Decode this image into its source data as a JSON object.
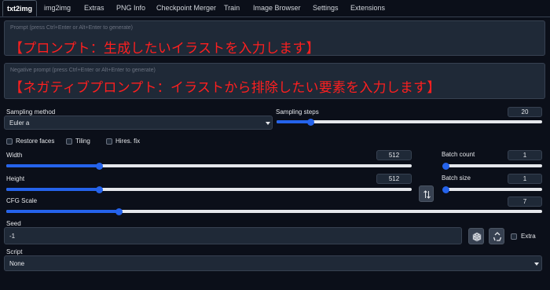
{
  "tabs": [
    {
      "label": "txt2img"
    },
    {
      "label": "img2img"
    },
    {
      "label": "Extras"
    },
    {
      "label": "PNG Info"
    },
    {
      "label": "Checkpoint Merger"
    },
    {
      "label": "Train"
    },
    {
      "label": "Image Browser"
    },
    {
      "label": "Settings"
    },
    {
      "label": "Extensions"
    }
  ],
  "prompt": {
    "placeholder": "Prompt (press Ctrl+Enter or Alt+Enter to generate)",
    "annotation": "【プロンプト：生成したいイラストを入力します】"
  },
  "negative_prompt": {
    "placeholder": "Negative prompt (press Ctrl+Enter or Alt+Enter to generate)",
    "annotation": "【ネガティブプロンプト：イラストから排除したい要素を入力します】"
  },
  "sampling_method": {
    "label": "Sampling method",
    "value": "Euler a"
  },
  "sampling_steps": {
    "label": "Sampling steps",
    "value": "20",
    "fraction": 0.13
  },
  "checkboxes": {
    "restore_faces": "Restore faces",
    "tiling": "Tiling",
    "hires_fix": "Hires. fix"
  },
  "width": {
    "label": "Width",
    "value": "512",
    "fraction": 0.23
  },
  "height": {
    "label": "Height",
    "value": "512",
    "fraction": 0.23
  },
  "swap_icon": "swap-icon",
  "batch_count": {
    "label": "Batch count",
    "value": "1",
    "fraction": 0.0
  },
  "batch_size": {
    "label": "Batch size",
    "value": "1",
    "fraction": 0.0
  },
  "cfg_scale": {
    "label": "CFG Scale",
    "value": "7",
    "fraction": 0.21
  },
  "seed": {
    "label": "Seed",
    "value": "-1",
    "extra_label": "Extra"
  },
  "script": {
    "label": "Script",
    "value": "None"
  },
  "colors": {
    "accent": "#2563eb",
    "annotation": "#ff1f1f",
    "background": "#0b0f19",
    "panel": "#1f2937"
  }
}
